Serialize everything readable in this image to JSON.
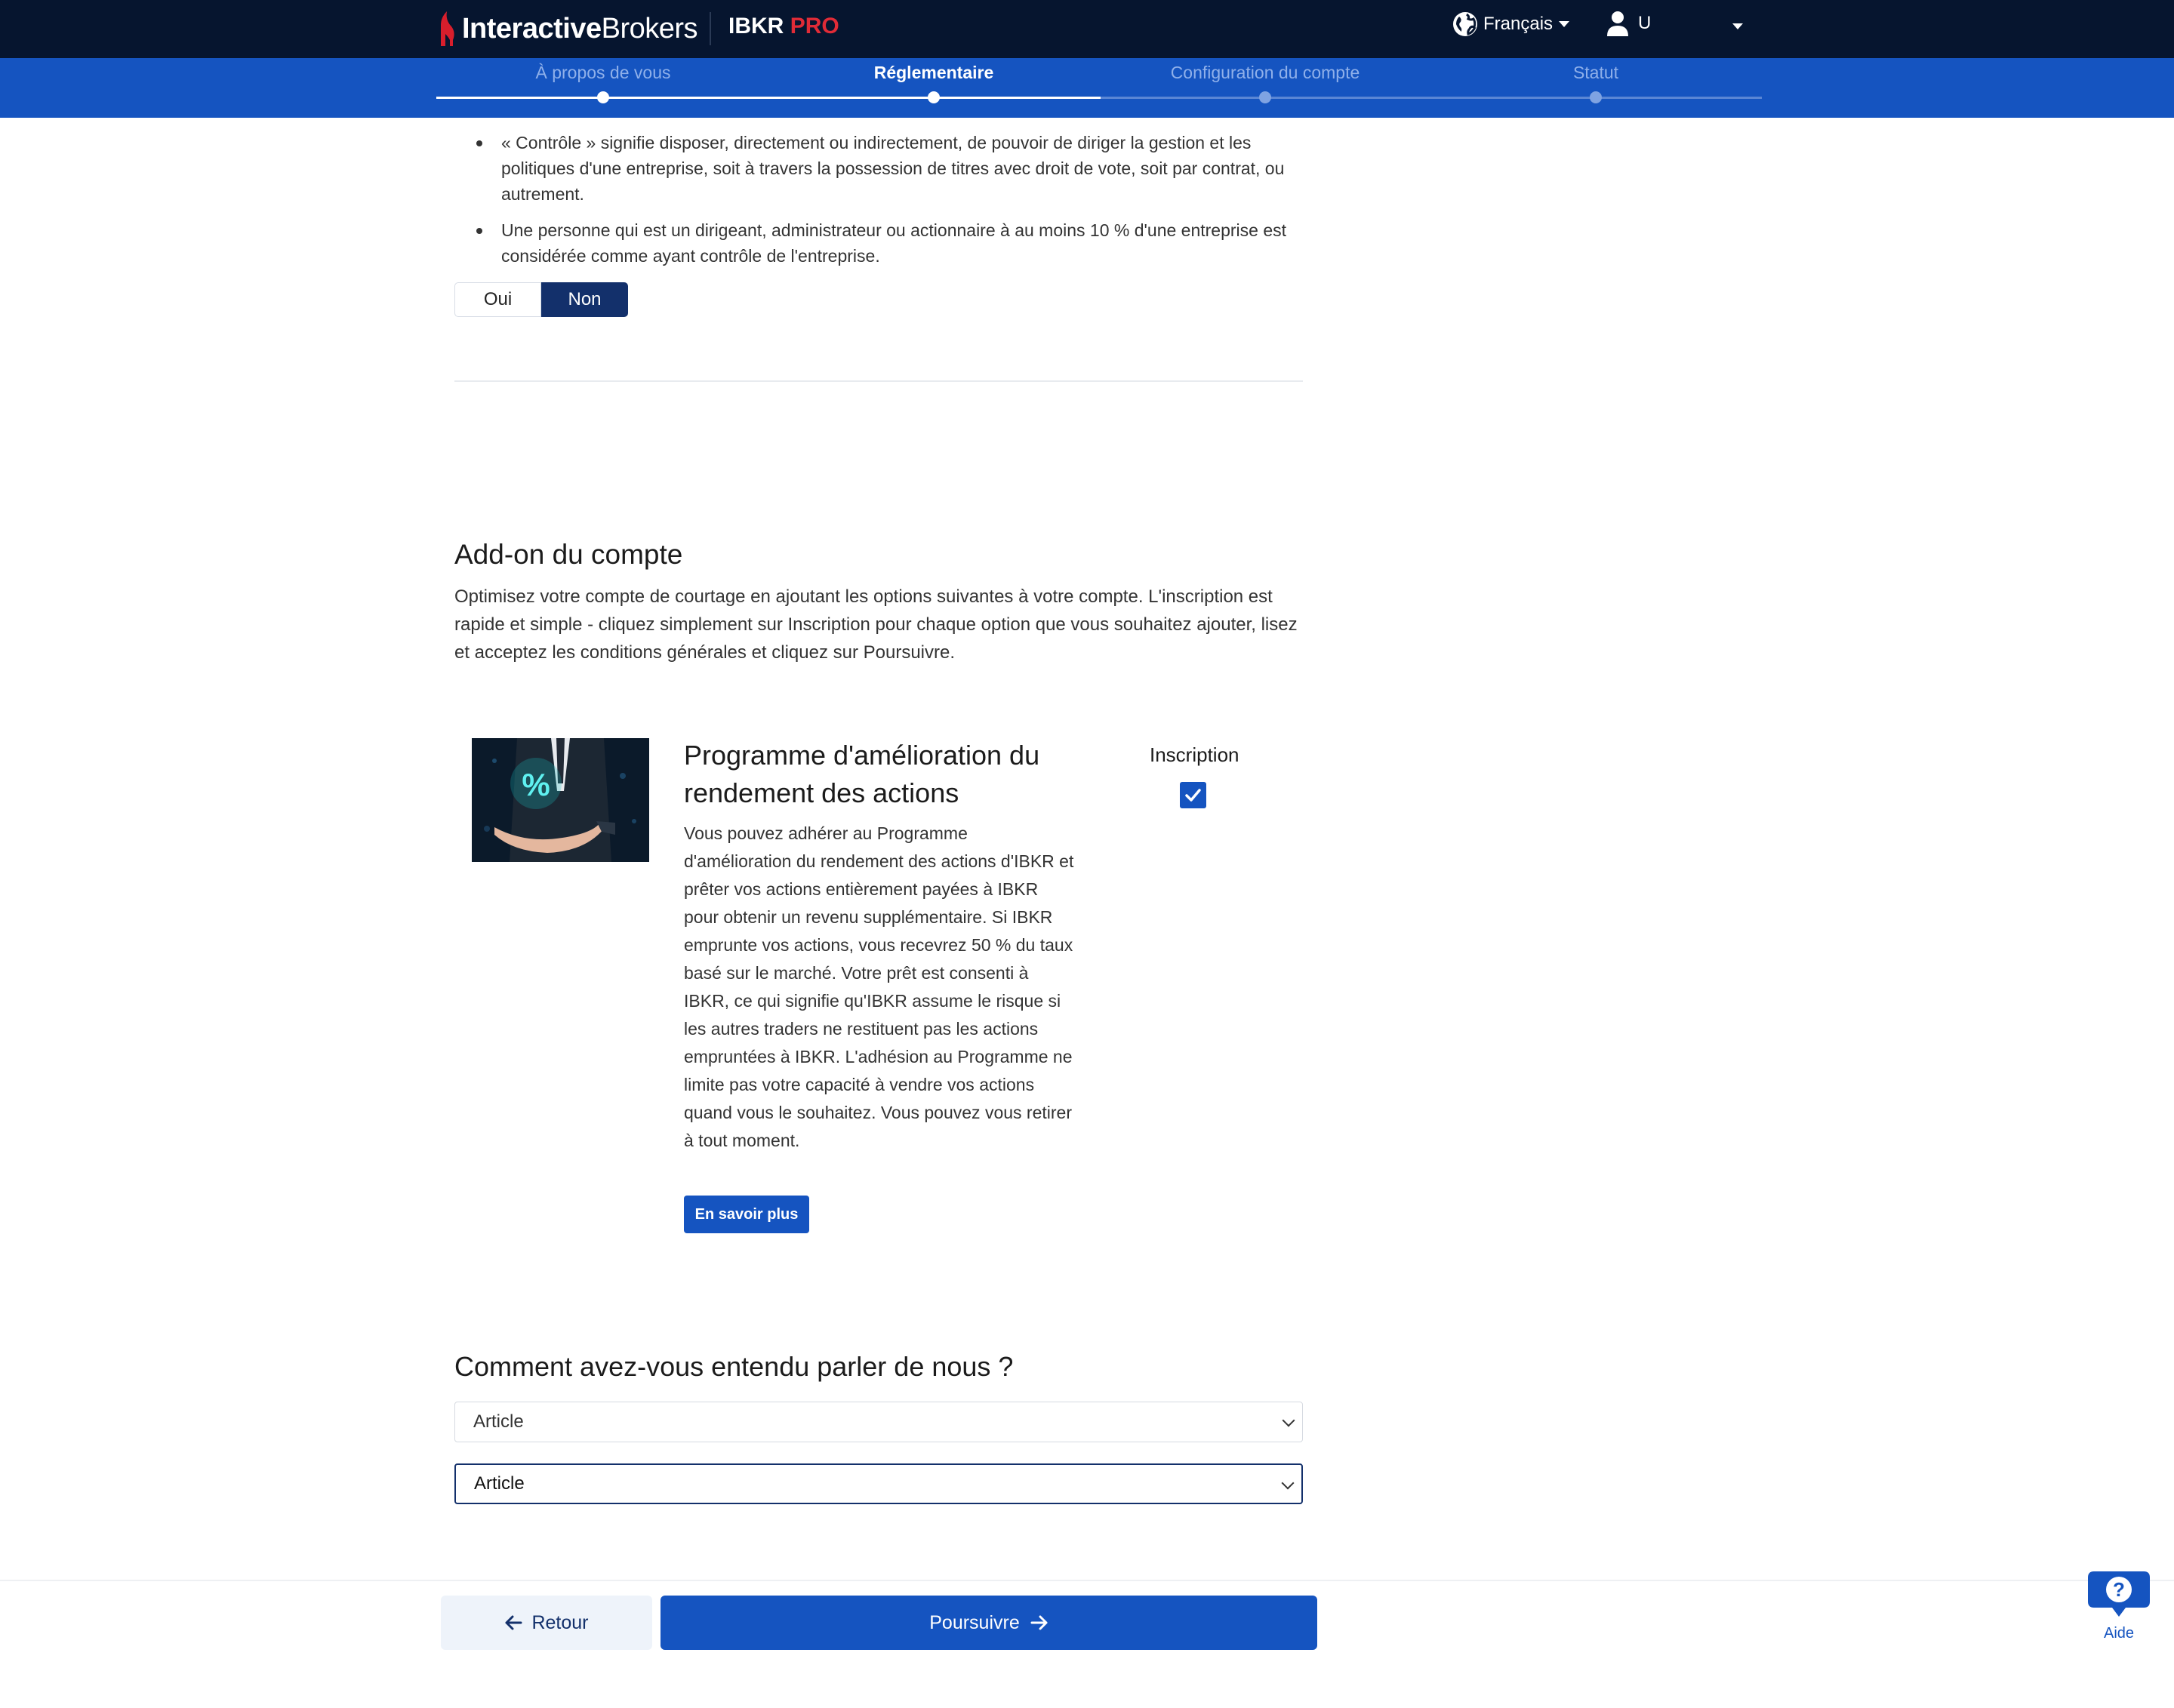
{
  "header": {
    "logo_bold": "Interactive",
    "logo_light": "Brokers",
    "product": "IBKR",
    "product_accent": "PRO",
    "language": "Français",
    "user": "U"
  },
  "steps": [
    {
      "label": "À propos de vous",
      "state": "done"
    },
    {
      "label": "Réglementaire",
      "state": "active"
    },
    {
      "label": "Configuration du compte",
      "state": "pending"
    },
    {
      "label": "Statut",
      "state": "pending"
    }
  ],
  "control": {
    "bullets": [
      "« Contrôle » signifie disposer, directement ou indirectement, de pouvoir de diriger la gestion et les politiques d'une entreprise, soit à travers la possession de titres avec droit de vote, soit par contrat, ou autrement.",
      "Une personne qui est un dirigeant, administrateur ou actionnaire à au moins 10 % d'une entreprise est considérée comme ayant contrôle de l'entreprise."
    ],
    "yes_label": "Oui",
    "no_label": "Non",
    "selected": "Non"
  },
  "addon": {
    "title": "Add-on du compte",
    "description": "Optimisez votre compte de courtage en ajoutant les options suivantes à votre compte. L'inscription est rapide et simple - cliquez simplement sur Inscription pour chaque option que vous souhaitez ajouter, lisez et acceptez les conditions générales et cliquez sur Poursuivre.",
    "card": {
      "image_symbol": "%",
      "title": "Programme d'amélioration du rendement des actions",
      "body": "Vous pouvez adhérer au Programme d'amélioration du rendement des actions d'IBKR et prêter vos actions entièrement payées à IBKR pour obtenir un revenu supplémentaire. Si IBKR emprunte vos actions, vous recevrez 50 % du taux basé sur le marché. Votre prêt est consenti à IBKR, ce qui signifie qu'IBKR assume le risque si les autres traders ne restituent pas les actions empruntées à IBKR. L'adhésion au Programme ne limite pas votre capacité à vendre vos actions quand vous le souhaitez. Vous pouvez vous retirer à tout moment.",
      "learn_more": "En savoir plus",
      "enroll_label": "Inscription",
      "enrolled": true
    }
  },
  "referral": {
    "title": "Comment avez-vous entendu parler de nous ?",
    "select1": "Article",
    "select2": "Article"
  },
  "footer": {
    "back": "Retour",
    "next": "Poursuivre",
    "help": "Aide"
  },
  "colors": {
    "navy": "#06152f",
    "brand_blue": "#1554c0",
    "dark_blue": "#13306b",
    "accent_red": "#e02b37"
  }
}
